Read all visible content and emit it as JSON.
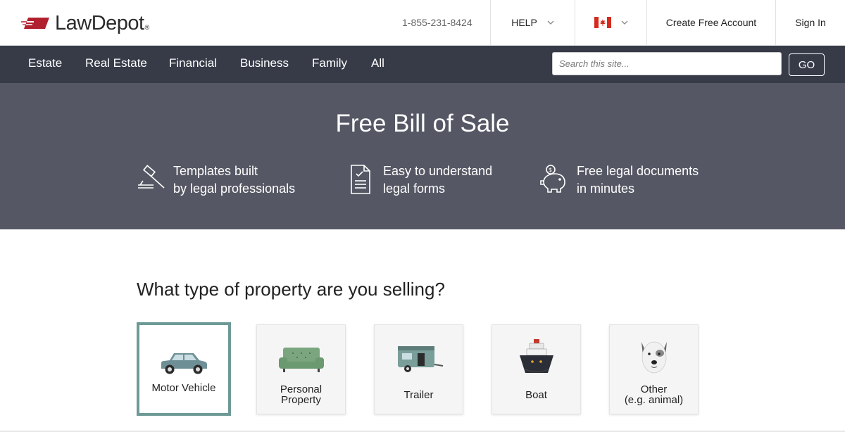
{
  "header": {
    "logo_text": "LawDepot",
    "logo_reg": "®",
    "phone": "1-855-231-8424",
    "help_label": "HELP",
    "country_flag": "canada-flag",
    "create_account_label": "Create Free Account",
    "sign_in_label": "Sign In"
  },
  "nav": {
    "items": [
      "Estate",
      "Real Estate",
      "Financial",
      "Business",
      "Family",
      "All"
    ],
    "search_placeholder": "Search this site...",
    "go_label": "GO"
  },
  "hero": {
    "title": "Free Bill of Sale",
    "features": [
      {
        "icon": "gavel-icon",
        "line1": "Templates built",
        "line2": "by legal professionals"
      },
      {
        "icon": "document-check-icon",
        "line1": "Easy to understand",
        "line2": "legal forms"
      },
      {
        "icon": "piggy-bank-icon",
        "line1": "Free legal documents",
        "line2": "in minutes"
      }
    ]
  },
  "question": "What type of property are you selling?",
  "property_types": [
    {
      "label": "Motor Vehicle",
      "icon": "car-icon",
      "selected": true
    },
    {
      "label": "Personal\nProperty",
      "icon": "sofa-icon",
      "selected": false
    },
    {
      "label": "Trailer",
      "icon": "trailer-icon",
      "selected": false
    },
    {
      "label": "Boat",
      "icon": "boat-icon",
      "selected": false
    },
    {
      "label": "Other\n(e.g. animal)",
      "icon": "dog-icon",
      "selected": false
    }
  ],
  "colors": {
    "nav_bg": "#373b48",
    "hero_bg": "#555864",
    "selected_border": "#6e9a96",
    "logo_red": "#b0202e"
  }
}
